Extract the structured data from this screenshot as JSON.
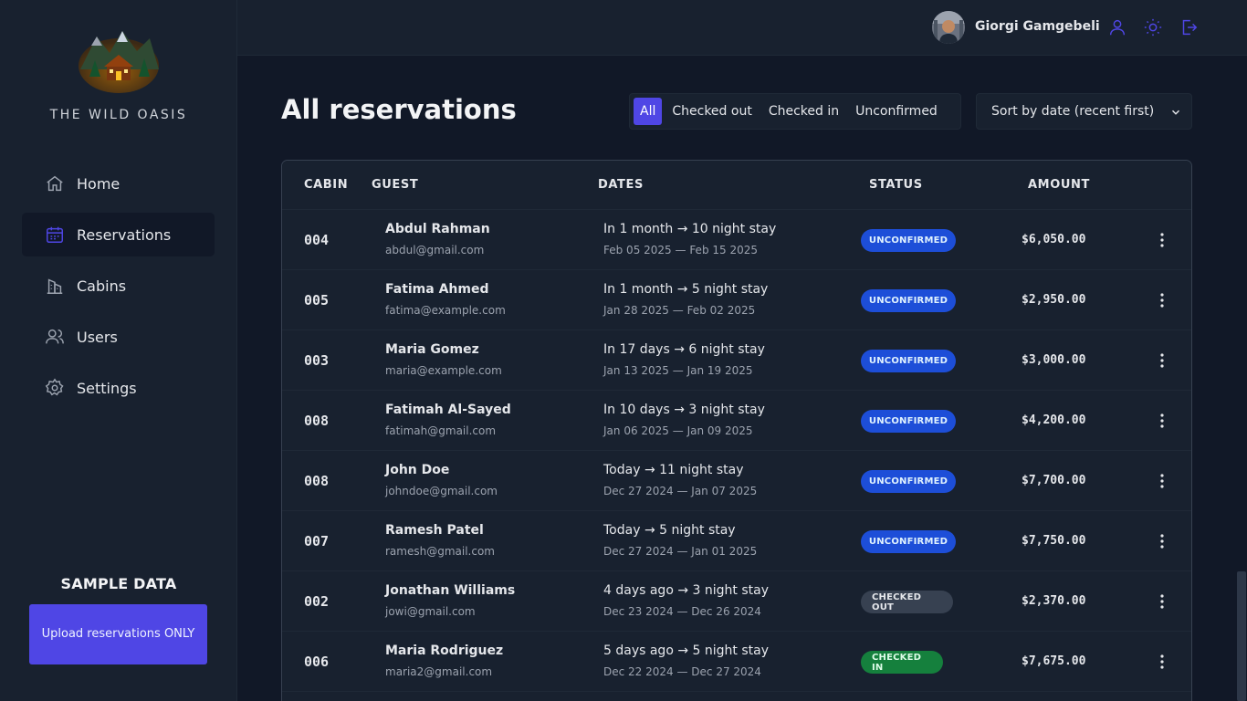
{
  "app": {
    "logo_text": "THE WILD OASIS"
  },
  "sidebar": {
    "items": [
      {
        "label": "Home",
        "icon": "home-icon",
        "active": false
      },
      {
        "label": "Reservations",
        "icon": "calendar-icon",
        "active": true
      },
      {
        "label": "Cabins",
        "icon": "building-icon",
        "active": false
      },
      {
        "label": "Users",
        "icon": "users-icon",
        "active": false
      },
      {
        "label": "Settings",
        "icon": "gear-icon",
        "active": false
      }
    ],
    "sample_title": "SAMPLE DATA",
    "upload_label": "Upload reservations ONLY"
  },
  "header": {
    "user_name": "Giorgi Gamgebeli",
    "buttons": [
      "user-icon",
      "sun-icon",
      "logout-icon"
    ]
  },
  "main": {
    "title": "All reservations",
    "filters": [
      "All",
      "Checked out",
      "Checked in",
      "Unconfirmed"
    ],
    "active_filter": "All",
    "sort_label": "Sort by date (recent first)"
  },
  "table": {
    "columns": [
      "CABIN",
      "GUEST",
      "DATES",
      "STATUS",
      "AMOUNT"
    ],
    "rows": [
      {
        "cabin": "004",
        "name": "Abdul Rahman",
        "email": "abdul@gmail.com",
        "when": "In 1 month → 10 night stay",
        "dates": "Feb 05 2025 — Feb 15 2025",
        "status": "UNCONFIRMED",
        "amount": "$6,050.00"
      },
      {
        "cabin": "005",
        "name": "Fatima Ahmed",
        "email": "fatima@example.com",
        "when": "In 1 month → 5 night stay",
        "dates": "Jan 28 2025 — Feb 02 2025",
        "status": "UNCONFIRMED",
        "amount": "$2,950.00"
      },
      {
        "cabin": "003",
        "name": "Maria Gomez",
        "email": "maria@example.com",
        "when": "In 17 days → 6 night stay",
        "dates": "Jan 13 2025 — Jan 19 2025",
        "status": "UNCONFIRMED",
        "amount": "$3,000.00"
      },
      {
        "cabin": "008",
        "name": "Fatimah Al-Sayed",
        "email": "fatimah@gmail.com",
        "when": "In 10 days → 3 night stay",
        "dates": "Jan 06 2025 — Jan 09 2025",
        "status": "UNCONFIRMED",
        "amount": "$4,200.00"
      },
      {
        "cabin": "008",
        "name": "John Doe",
        "email": "johndoe@gmail.com",
        "when": "Today → 11 night stay",
        "dates": "Dec 27 2024 — Jan 07 2025",
        "status": "UNCONFIRMED",
        "amount": "$7,700.00"
      },
      {
        "cabin": "007",
        "name": "Ramesh Patel",
        "email": "ramesh@gmail.com",
        "when": "Today → 5 night stay",
        "dates": "Dec 27 2024 — Jan 01 2025",
        "status": "UNCONFIRMED",
        "amount": "$7,750.00"
      },
      {
        "cabin": "002",
        "name": "Jonathan Williams",
        "email": "jowi@gmail.com",
        "when": "4 days ago → 3 night stay",
        "dates": "Dec 23 2024 — Dec 26 2024",
        "status": "CHECKED OUT",
        "amount": "$2,370.00"
      },
      {
        "cabin": "006",
        "name": "Maria Rodriguez",
        "email": "maria2@gmail.com",
        "when": "5 days ago → 5 night stay",
        "dates": "Dec 22 2024 — Dec 27 2024",
        "status": "CHECKED IN",
        "amount": "$7,675.00"
      }
    ]
  },
  "colors": {
    "accent": "#4f46e5",
    "unconfirmed": "#1d4ed8",
    "checked_out": "#374151",
    "checked_in": "#15803d"
  }
}
